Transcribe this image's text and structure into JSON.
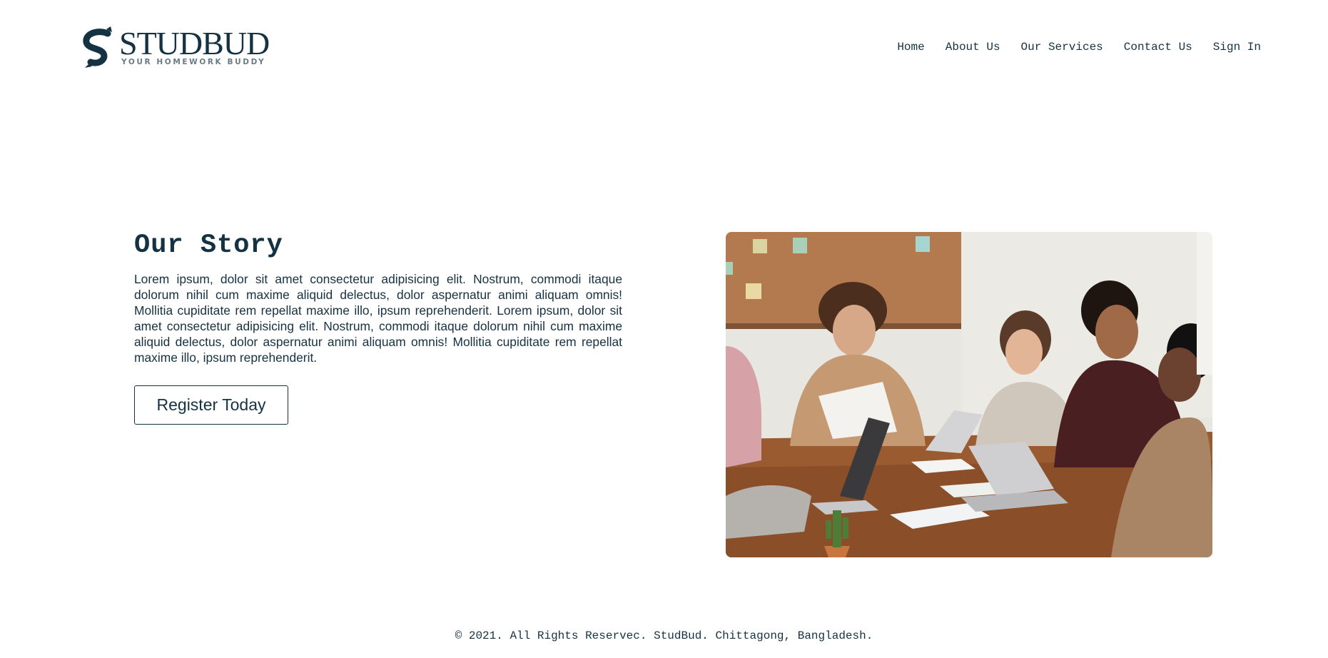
{
  "header": {
    "logo_text": "STUDBUD",
    "logo_tagline": "YOUR HOMEWORK BUDDY",
    "nav": [
      {
        "label": "Home"
      },
      {
        "label": "About Us"
      },
      {
        "label": "Our Services"
      },
      {
        "label": "Contact Us"
      },
      {
        "label": "Sign In"
      }
    ]
  },
  "story": {
    "title": "Our Story",
    "body": "Lorem ipsum, dolor sit amet consectetur adipisicing elit. Nostrum, commodi itaque dolorum nihil cum maxime aliquid delectus, dolor aspernatur animi aliquam omnis! Mollitia cupiditate rem repellat maxime illo, ipsum reprehenderit. Lorem ipsum, dolor sit amet consectetur adipisicing elit. Nostrum, commodi itaque dolorum nihil cum maxime aliquid delectus, dolor aspernatur animi aliquam omnis! Mollitia cupiditate rem repellat maxime illo, ipsum reprehenderit.",
    "cta_label": "Register Today"
  },
  "footer": {
    "copyright": "© 2021. All Rights Reservec. StudBud. Chittagong, Bangladesh."
  },
  "colors": {
    "primary": "#153243",
    "background": "#ffffff",
    "tagline": "#6a7a86"
  }
}
